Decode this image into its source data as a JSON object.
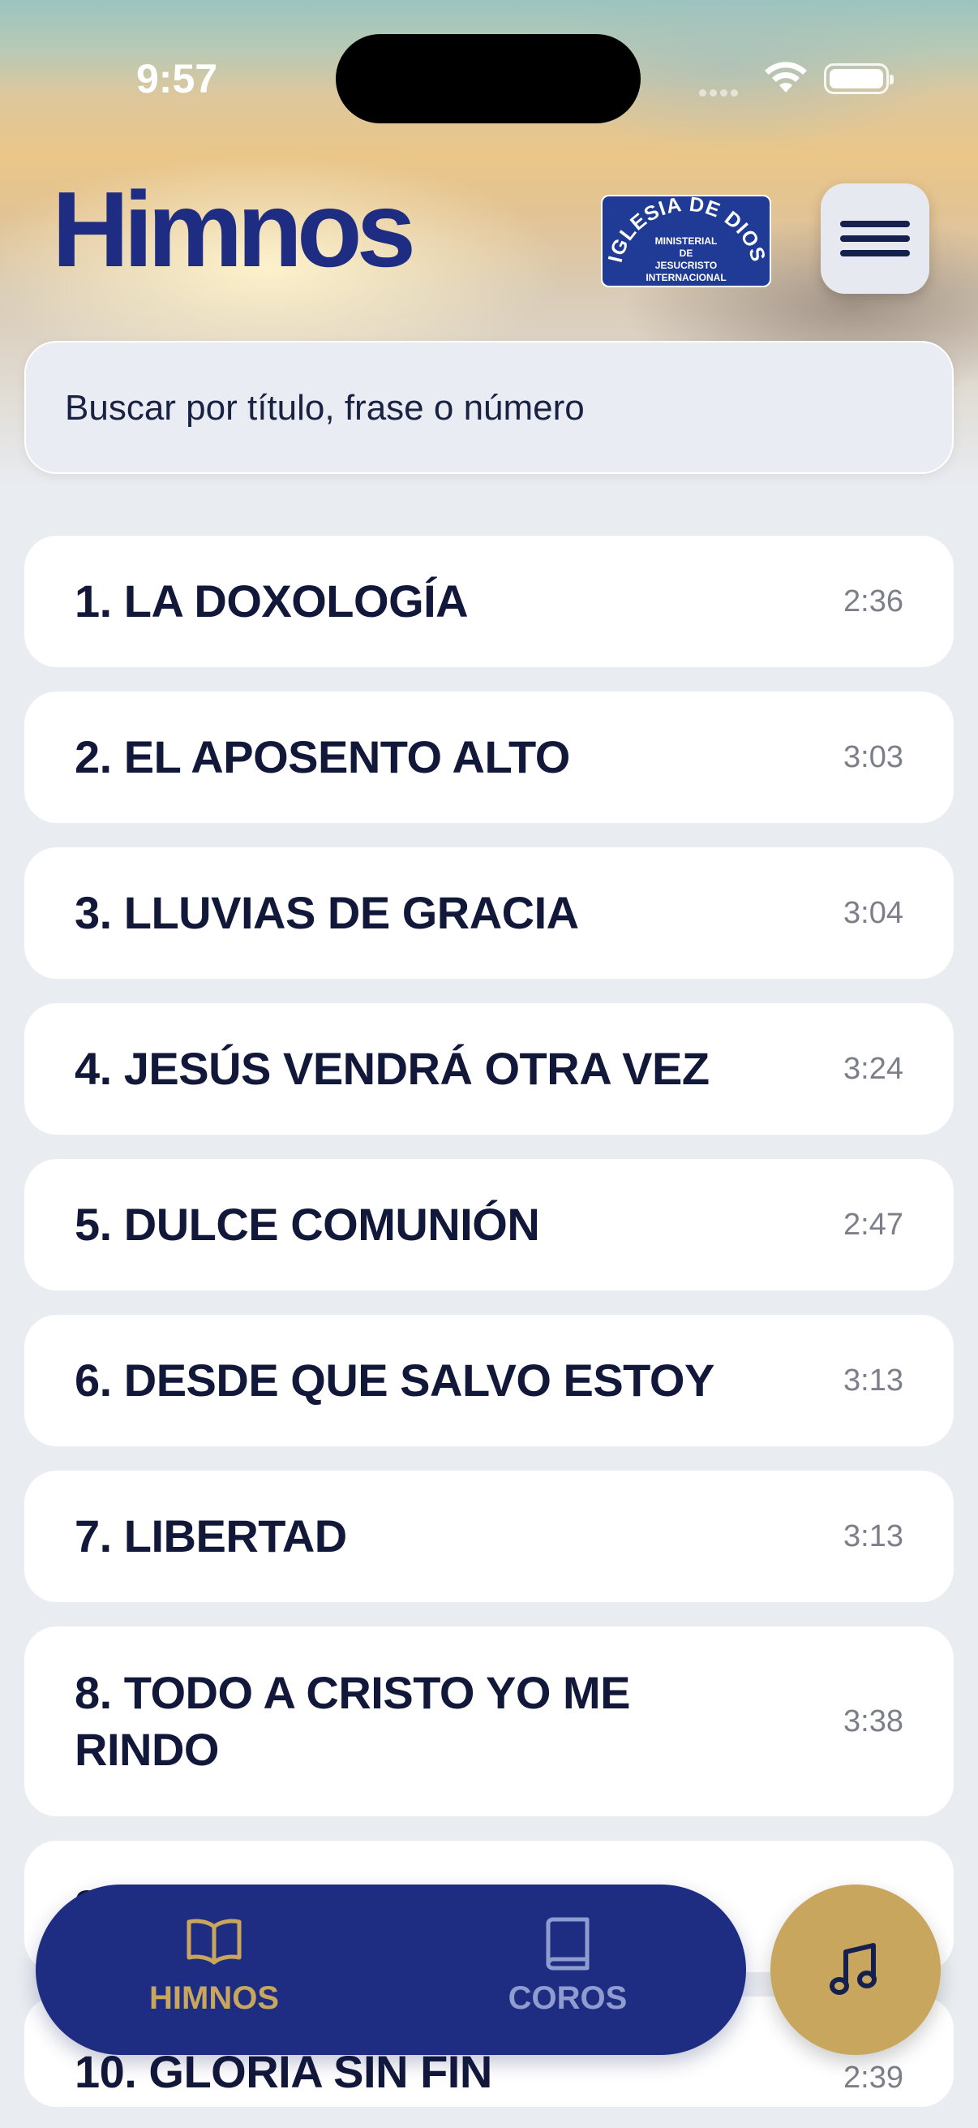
{
  "status_bar": {
    "time": "9:57"
  },
  "header": {
    "title": "Himnos",
    "logo": {
      "arc_text": "IGLESIA DE DIOS",
      "lines": [
        "MINISTERIAL",
        "DE",
        "JESUCRISTO",
        "INTERNACIONAL"
      ]
    },
    "menu_icon": "hamburger-menu-icon"
  },
  "search": {
    "placeholder": "Buscar por título, frase o número"
  },
  "hymns": [
    {
      "title": "1. LA DOXOLOGÍA",
      "duration": "2:36"
    },
    {
      "title": "2. EL APOSENTO ALTO",
      "duration": "3:03"
    },
    {
      "title": "3. LLUVIAS DE GRACIA",
      "duration": "3:04"
    },
    {
      "title": "4. JESÚS VENDRÁ OTRA VEZ",
      "duration": "3:24"
    },
    {
      "title": "5. DULCE COMUNIÓN",
      "duration": "2:47"
    },
    {
      "title": "6. DESDE QUE SALVO ESTOY",
      "duration": "3:13"
    },
    {
      "title": "7. LIBERTAD",
      "duration": "3:13"
    },
    {
      "title": "8. TODO A CRISTO YO ME RINDO",
      "duration": "3:38"
    },
    {
      "title": "9.",
      "duration": ""
    },
    {
      "title": "10. GLORIA SIN FIN",
      "duration": "2:39"
    }
  ],
  "tabbar": {
    "tabs": [
      {
        "label": "HIMNOS",
        "icon": "open-book-icon",
        "active": true
      },
      {
        "label": "COROS",
        "icon": "closed-book-icon",
        "active": false
      }
    ],
    "fab_icon": "music-note-icon"
  },
  "colors": {
    "brand_blue": "#1e2d82",
    "gold": "#c9a65d",
    "inactive_tab": "#8f9ccf",
    "background": "#e9ecf1"
  }
}
